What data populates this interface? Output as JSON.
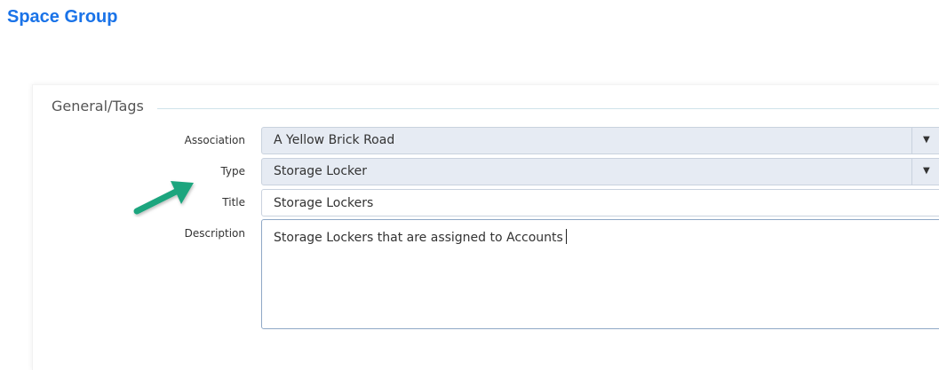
{
  "page": {
    "title": "Space Group"
  },
  "section": {
    "legend": "General/Tags"
  },
  "fields": {
    "association": {
      "label": "Association",
      "value": "A Yellow Brick Road"
    },
    "type": {
      "label": "Type",
      "value": "Storage Locker"
    },
    "title": {
      "label": "Title",
      "value": "Storage Lockers"
    },
    "description": {
      "label": "Description",
      "value": "Storage Lockers that are assigned to Accounts"
    }
  },
  "icons": {
    "dropdown": "chevron-down-icon",
    "annotation": "green-arrow-icon"
  },
  "colors": {
    "title": "#1a73e8",
    "select_bg": "#e6ebf3",
    "annotation_arrow": "#1fa57e"
  }
}
